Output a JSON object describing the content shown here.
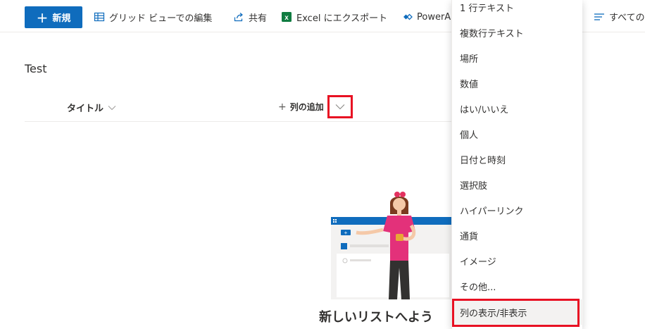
{
  "toolbar": {
    "new_label": "新規",
    "grid_edit_label": "グリッド ビューでの編集",
    "share_label": "共有",
    "excel_export_label": "Excel にエクスポート",
    "powerapps_label": "PowerA",
    "all_items_label": "すべての"
  },
  "list": {
    "title": "Test",
    "columns": {
      "title_label": "タイトル",
      "add_column_label": "列の追加"
    },
    "empty_state_title": "新しいリストへよう"
  },
  "column_type_menu": {
    "items": [
      "1 行テキスト",
      "複数行テキスト",
      "場所",
      "数値",
      "はい/いいえ",
      "個人",
      "日付と時刻",
      "選択肢",
      "ハイパーリンク",
      "通貨",
      "イメージ",
      "その他...",
      "列の表示/非表示"
    ],
    "highlighted_item": "列の表示/非表示"
  },
  "colors": {
    "accent": "#0f6cbd",
    "highlight_border": "#e81123",
    "excel_green": "#107c41"
  }
}
